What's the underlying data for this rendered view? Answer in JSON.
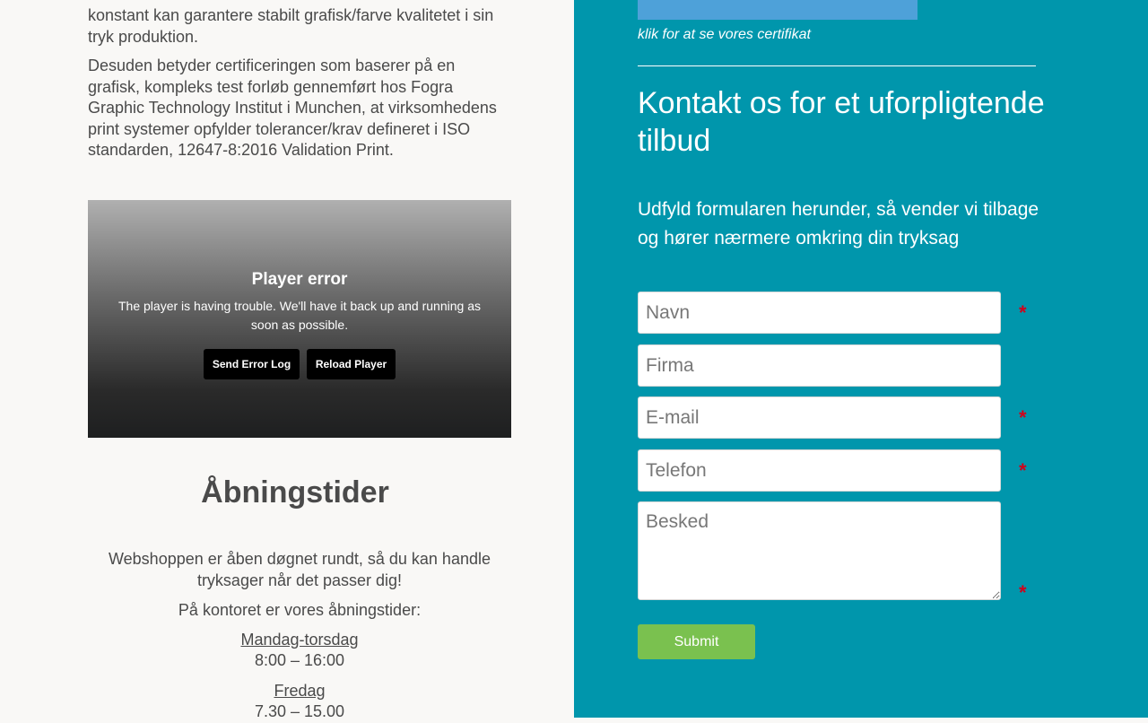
{
  "left": {
    "para1_partial": "konstant kan garantere stabilt grafisk/farve kvalitetet i sin tryk produktion.",
    "para2": "Desuden betyder certificeringen som baserer på en grafisk, kompleks test forløb gennemført hos Fogra Graphic Technology Institut i Munchen, at virksomhedens print systemer opfylder tolerancer/krav defineret i ISO standarden, 12647-8:2016 Validation Print.",
    "player": {
      "title": "Player error",
      "message": "The player is having trouble. We'll have it back up and running as soon as possible.",
      "send_log_label": "Send Error Log",
      "reload_label": "Reload Player"
    },
    "hours": {
      "title": "Åbningstider",
      "webshop_text": "Webshoppen er åben døgnet rundt, så du kan handle tryksager når det passer dig!",
      "office_intro": "På kontoret er vores åbningstider:",
      "weekdays_label": "Mandag-torsdag",
      "weekdays_time": "8:00 – 16:00",
      "friday_label": "Fredag",
      "friday_time": "7.30 – 15.00"
    }
  },
  "right": {
    "cert_link": "klik for at se vores certifikat",
    "contact_title": "Kontakt os for et uforpligtende tilbud",
    "contact_subtitle": "Udfyld formularen herunder, så vender vi tilbage og hører nærmere omkring din tryksag",
    "form": {
      "name_placeholder": "Navn",
      "company_placeholder": "Firma",
      "email_placeholder": "E-mail",
      "phone_placeholder": "Telefon",
      "message_placeholder": "Besked",
      "required_marker": "*",
      "submit_label": "Submit"
    }
  },
  "colors": {
    "right_bg": "#0096ac",
    "left_bg": "#f9f8f6",
    "submit_bg": "#7ac14f",
    "required": "#d0021b",
    "cert_image": "#4ea1d9"
  }
}
